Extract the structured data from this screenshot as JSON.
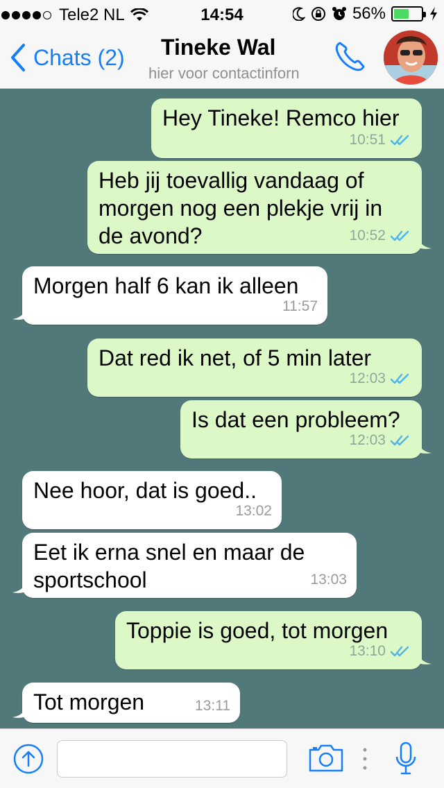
{
  "status_bar": {
    "carrier": "Tele2 NL",
    "time": "14:54",
    "battery": "56%",
    "battery_level": 0.56
  },
  "nav": {
    "back_label": "Chats (2)",
    "title": "Tineke Wal",
    "subtitle": "hier voor contactinforn"
  },
  "messages": [
    {
      "dir": "out",
      "text": "Hey Tineke! Remco hier",
      "time": "10:51",
      "read": true
    },
    {
      "dir": "out",
      "text": "Heb jij toevallig vandaag of\nmorgen nog een plekje vrij in\nde avond?",
      "time": "10:52",
      "read": true
    },
    {
      "dir": "in",
      "text": "Morgen half 6 kan ik alleen",
      "time": "11:57"
    },
    {
      "dir": "out",
      "text": "Dat red ik net, of 5 min later",
      "time": "12:03",
      "read": true
    },
    {
      "dir": "out",
      "text": "Is dat een probleem?",
      "time": "12:03",
      "read": true
    },
    {
      "dir": "in",
      "text": "Nee hoor, dat is goed..",
      "time": "13:02"
    },
    {
      "dir": "in",
      "text": "Eet ik erna snel en maar de\nsportschool",
      "time": "13:03"
    },
    {
      "dir": "out",
      "text": "Toppie is goed, tot morgen",
      "time": "13:10",
      "read": true
    },
    {
      "dir": "in",
      "text": "Tot morgen",
      "time": "13:11"
    }
  ],
  "input": {
    "value": "",
    "placeholder": ""
  },
  "colors": {
    "background": "#52797a",
    "outgoing_bubble": "#dcf8c6",
    "incoming_bubble": "#ffffff",
    "accent": "#157efb",
    "read_check": "#4fb6ec"
  },
  "icons": [
    "wifi-icon",
    "moon-icon",
    "rotation-lock-icon",
    "alarm-icon",
    "charging-icon",
    "chevron-left-icon",
    "phone-icon",
    "avatar",
    "double-check-icon",
    "upload-arrow-icon",
    "camera-icon",
    "microphone-icon"
  ]
}
